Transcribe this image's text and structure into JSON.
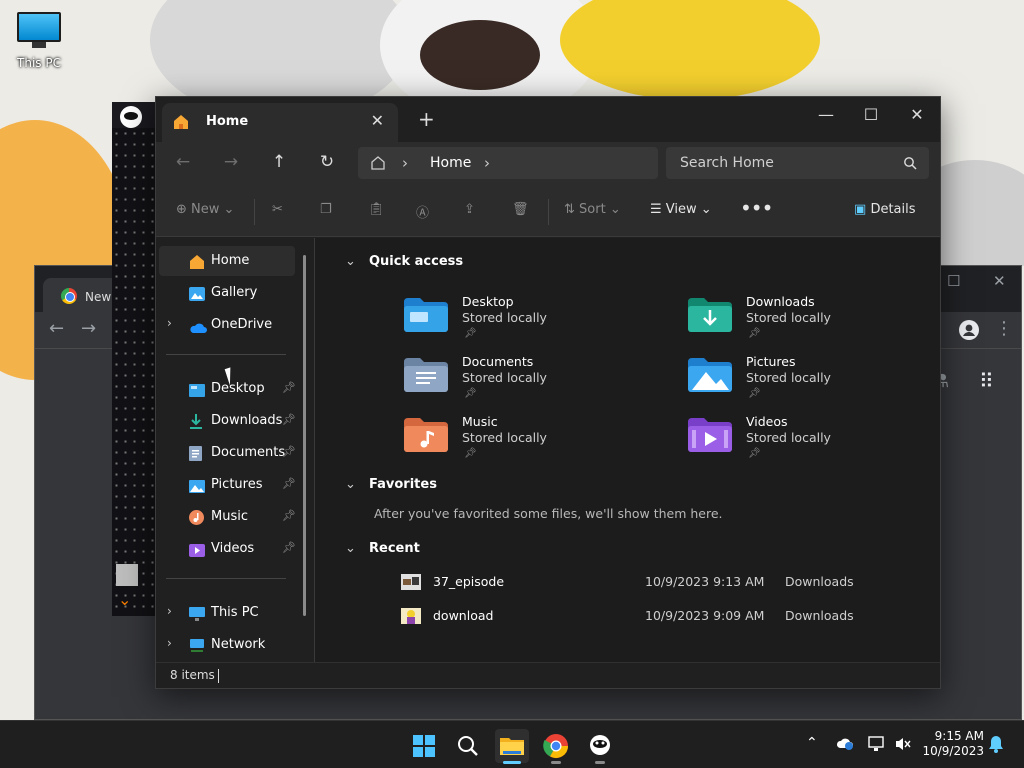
{
  "desktop": {
    "this_pc_label": "This PC"
  },
  "chrome": {
    "tab_title": "New Ta"
  },
  "explorer": {
    "tab_title": "Home",
    "address_crumb": "Home",
    "search_placeholder": "Search Home",
    "commands": {
      "new": "New",
      "sort": "Sort",
      "view": "View",
      "details": "Details"
    },
    "sidebar": {
      "top": [
        {
          "label": "Home",
          "icon": "home-icon",
          "selected": true
        },
        {
          "label": "Gallery",
          "icon": "gallery-icon"
        },
        {
          "label": "OneDrive",
          "icon": "onedrive-icon",
          "expandable": true
        }
      ],
      "pinned": [
        {
          "label": "Desktop",
          "icon": "desktop-folder-icon"
        },
        {
          "label": "Downloads",
          "icon": "downloads-icon"
        },
        {
          "label": "Documents",
          "icon": "documents-icon"
        },
        {
          "label": "Pictures",
          "icon": "pictures-icon"
        },
        {
          "label": "Music",
          "icon": "music-icon"
        },
        {
          "label": "Videos",
          "icon": "videos-icon"
        }
      ],
      "bottom": [
        {
          "label": "This PC",
          "icon": "this-pc-icon"
        },
        {
          "label": "Network",
          "icon": "network-icon"
        }
      ]
    },
    "sections": {
      "quick_access": "Quick access",
      "favorites": "Favorites",
      "recent": "Recent"
    },
    "quick_access": [
      {
        "name": "Desktop",
        "sub": "Stored locally",
        "color": "#35a3e8"
      },
      {
        "name": "Downloads",
        "sub": "Stored locally",
        "color": "#2bb6a0"
      },
      {
        "name": "Documents",
        "sub": "Stored locally",
        "color": "#8fa6c4"
      },
      {
        "name": "Pictures",
        "sub": "Stored locally",
        "color": "#3aa7f0"
      },
      {
        "name": "Music",
        "sub": "Stored locally",
        "color": "#f08a5d"
      },
      {
        "name": "Videos",
        "sub": "Stored locally",
        "color": "#9b5ee6"
      }
    ],
    "favorites_message": "After you've favorited some files, we'll show them here.",
    "recent": [
      {
        "name": "37_episode",
        "date": "10/9/2023 9:13 AM",
        "location": "Downloads"
      },
      {
        "name": "download",
        "date": "10/9/2023 9:09 AM",
        "location": "Downloads"
      }
    ],
    "status": "8 items"
  },
  "taskbar": {
    "time": "9:15 AM",
    "date": "10/9/2023"
  },
  "colors": {
    "accent": "#60cdff",
    "window_bg": "#202020"
  }
}
